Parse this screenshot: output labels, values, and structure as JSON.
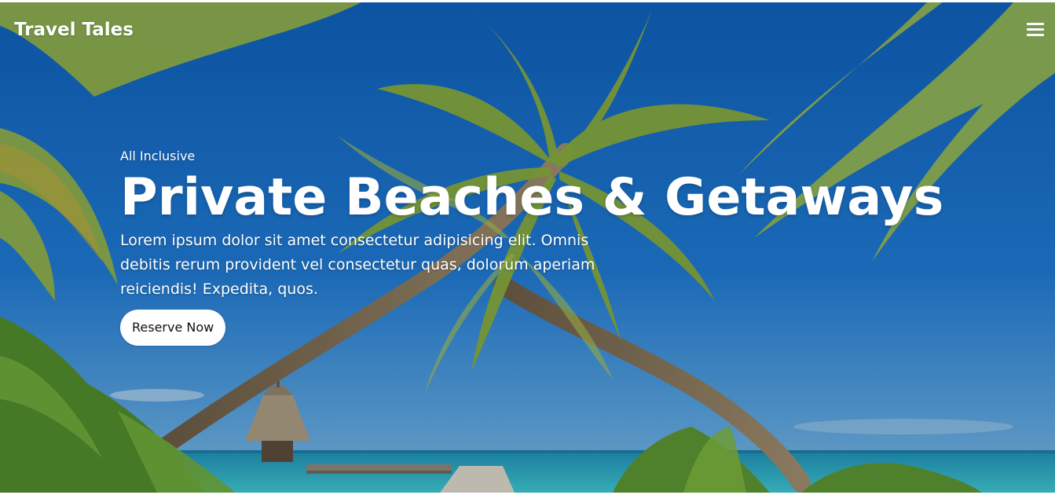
{
  "navbar": {
    "brand": "Travel Tales",
    "menu_icon": "hamburger-menu-icon"
  },
  "hero": {
    "eyebrow": "All Inclusive",
    "headline": "Private Beaches & Getaways",
    "description": "Lorem ipsum dolor sit amet consectetur adipisicing elit. Omnis debitis rerum provident vel consectetur quas, dolorum aperiam reiciendis! Expedita, quos.",
    "cta_label": "Reserve Now",
    "background_image": "tropical-beach-palm-trees"
  },
  "colors": {
    "sky": "#1e6fc4",
    "sky_light": "#3a8ee0",
    "sea": "#2fb3c7",
    "palm_green": "#7ea23a",
    "foliage_dark": "#3f6b22",
    "text": "#ffffff",
    "button_bg": "#ffffff",
    "button_text": "#111111"
  }
}
